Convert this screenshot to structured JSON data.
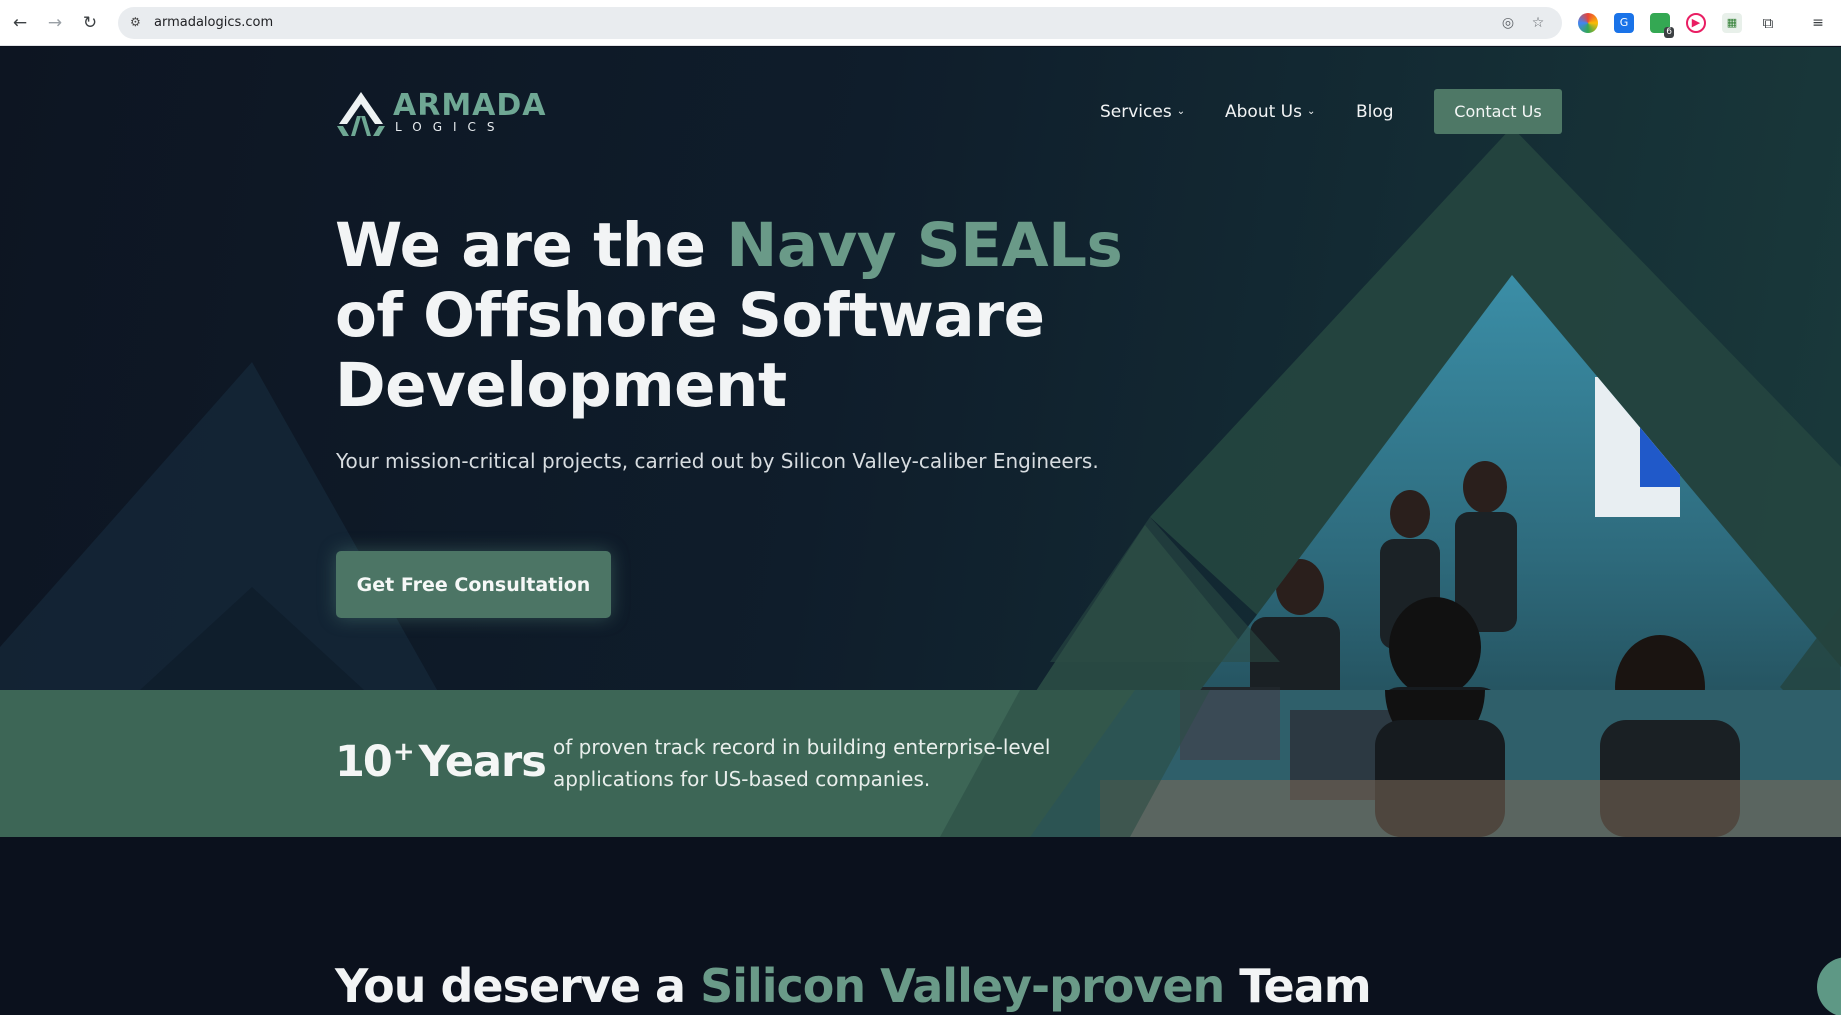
{
  "browser": {
    "url": "armadalogics.com",
    "extension_badge": "6"
  },
  "brand": {
    "name": "ARMADA",
    "sub": "LOGICS",
    "accent_color": "#6fa894",
    "button_color": "#4e7866"
  },
  "nav": {
    "items": [
      {
        "label": "Services",
        "has_dropdown": true
      },
      {
        "label": "About Us",
        "has_dropdown": true
      },
      {
        "label": "Blog",
        "has_dropdown": false
      }
    ],
    "contact_label": "Contact Us"
  },
  "hero": {
    "headline_prefix": "We are the ",
    "headline_accent": "Navy SEALs",
    "headline_line2": "of Offshore Software",
    "headline_line3": "Development",
    "subline": "Your mission-critical projects, carried out by Silicon Valley-caliber Engineers.",
    "cta_label": "Get Free Consultation"
  },
  "stats": {
    "number": "10",
    "plus": "+",
    "unit": "Years",
    "description_line1": "of proven track record in building enterprise-level",
    "description_line2": "applications for US-based companies."
  },
  "section2": {
    "prefix": "You deserve a ",
    "accent": "Silicon Valley-proven",
    "suffix": " Team"
  }
}
